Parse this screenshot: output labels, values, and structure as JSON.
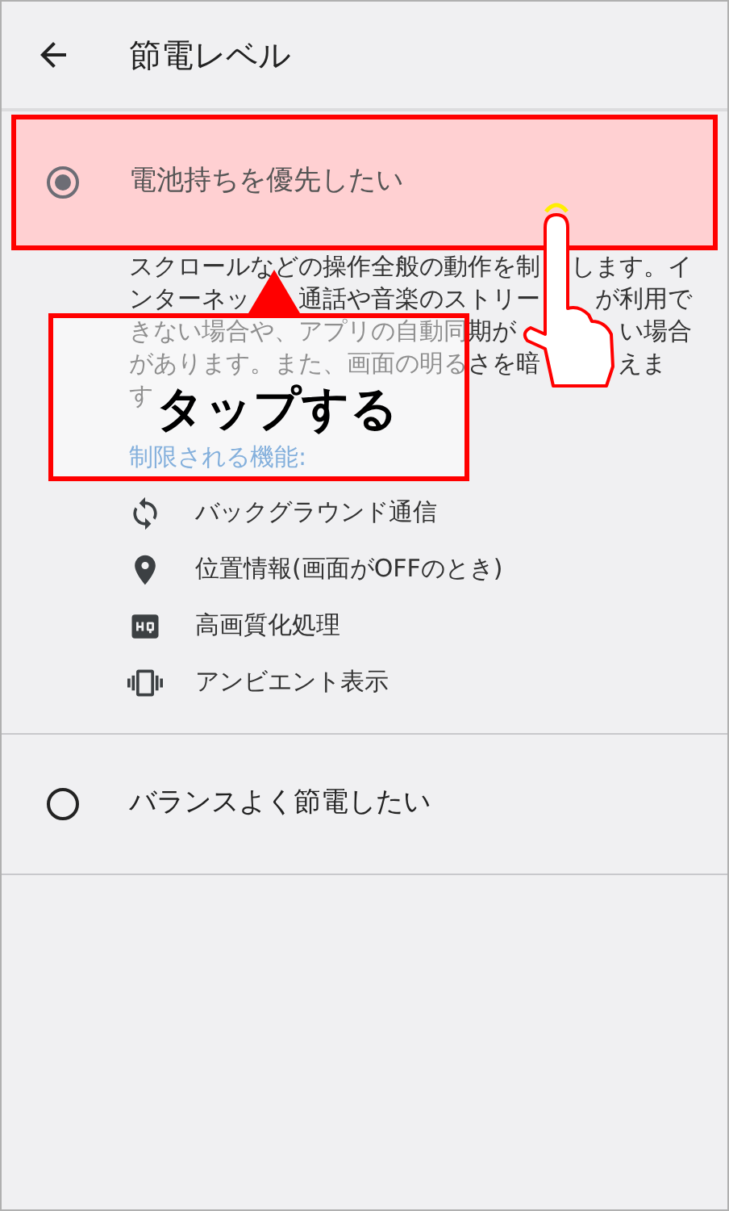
{
  "header": {
    "title": "節電レベル"
  },
  "options": [
    {
      "label": "電池持ちを優先したい",
      "selected": true,
      "highlighted": true,
      "description_lines": [
        [
          "スクロールなどの操作全般の動作を制",
          "します。イ"
        ],
        [
          "ンターネッ",
          "通話や音楽のストリー",
          "が利用で"
        ],
        [
          "きない場合や、アプリの自動同期が",
          "い場合"
        ],
        [
          "があります。また、画面の明るさを暗",
          "えま"
        ],
        [
          "す"
        ]
      ],
      "restricted_heading": "制限される機能:",
      "restricted_features": [
        {
          "label": "バックグラウンド通信",
          "kind": "sync"
        },
        {
          "label": "位置情報(画面がOFFのとき)",
          "kind": "location"
        },
        {
          "label": "高画質化処理",
          "kind": "hq"
        },
        {
          "label": "アンビエント表示",
          "kind": "ambient"
        }
      ]
    },
    {
      "label": "バランスよく節電したい",
      "selected": false,
      "highlighted": false
    }
  ],
  "annotation": {
    "callout": "タップする"
  }
}
